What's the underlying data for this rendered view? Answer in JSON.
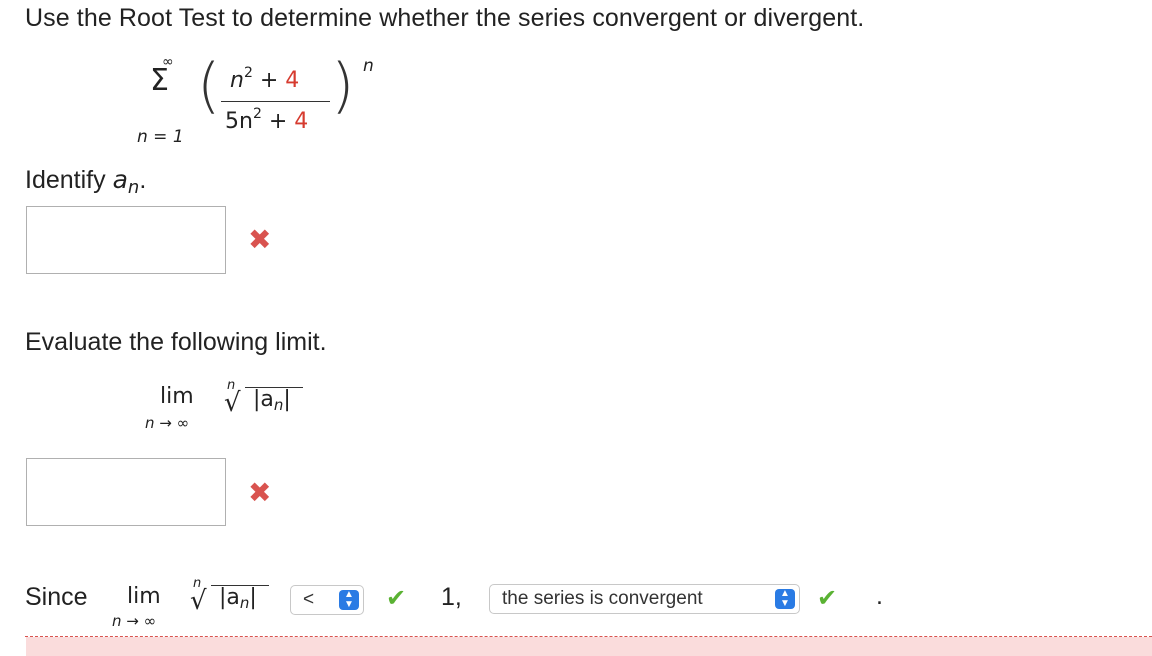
{
  "question": {
    "title": "Use the Root Test to determine whether the series convergent or divergent."
  },
  "series": {
    "sum_upper": "∞",
    "sum_lower": "n = 1",
    "numerator_var": "n",
    "numerator_exp": "2",
    "numerator_op": " + ",
    "numerator_const": "4",
    "denominator_coef": "5n",
    "denominator_exp": "2",
    "denominator_op": " + ",
    "denominator_const": "4",
    "outer_exp": "n"
  },
  "part1": {
    "prompt": "Identify",
    "prompt_var": "a",
    "prompt_sub": "n",
    "prompt_end": ".",
    "answer_value": "",
    "status_icon": "x-mark-icon"
  },
  "part2": {
    "prompt": "Evaluate the following limit.",
    "lim": "lim",
    "lim_sub": "n → ∞",
    "root_index": "n",
    "radicand": "|a",
    "radicand_sub": "n",
    "radicand_end": "|",
    "answer_value": "",
    "status_icon": "x-mark-icon"
  },
  "part3": {
    "since": "Since",
    "lim": "lim",
    "lim_sub": "n → ∞",
    "root_index": "n",
    "radicand": "|a",
    "radicand_sub": "n",
    "radicand_end": "|",
    "comparison_selected": "<",
    "compare_value": "1,",
    "conclusion_selected": "the series is convergent",
    "end_period": ".",
    "status_icon": "check-mark-icon"
  },
  "colors": {
    "error": "#d9534f",
    "correct": "#5ab233",
    "select_accent": "#2a7be4",
    "feedback_bg": "#fadcdc"
  }
}
